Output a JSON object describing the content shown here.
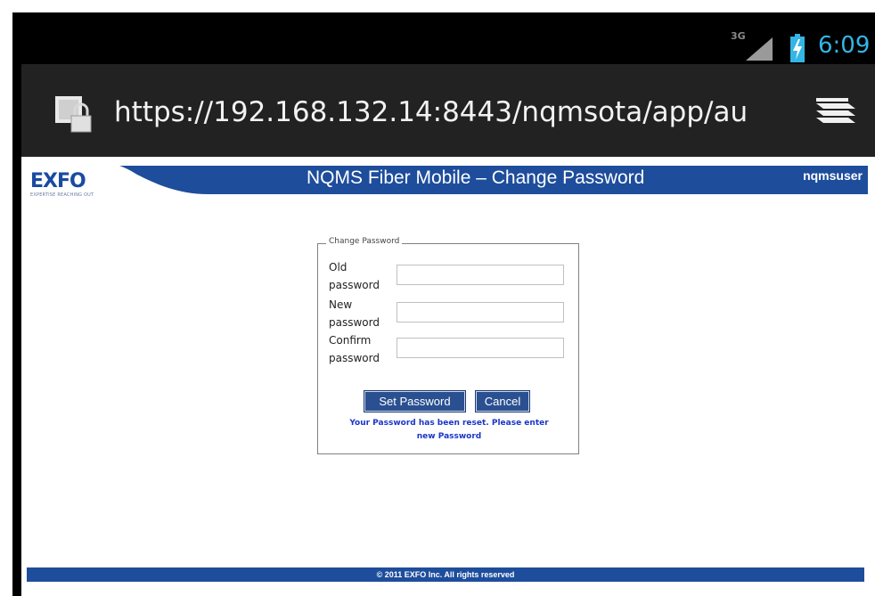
{
  "status_bar": {
    "network": "3G",
    "time": "6:09",
    "clock_color": "#33b5e5"
  },
  "browser": {
    "url": "https://192.168.132.14:8443/nqmsota/app/au",
    "icons": [
      "lock-icon",
      "menu-icon"
    ]
  },
  "header": {
    "logo": "EXFO",
    "tagline": "EXPERTISE REACHING OUT",
    "title": "NQMS Fiber Mobile – Change Password",
    "user": "nqmsuser",
    "band_color": "#1e4d9c"
  },
  "form": {
    "legend": "Change Password",
    "fields": [
      {
        "label_line1": "Old",
        "label_line2": "password",
        "value": ""
      },
      {
        "label_line1": "New",
        "label_line2": "password",
        "value": ""
      },
      {
        "label_line1": "Confirm",
        "label_line2": "password",
        "value": ""
      }
    ],
    "set_button": "Set Password",
    "cancel_button": "Cancel",
    "message_line1": "Your Password has been reset. Please enter",
    "message_line2": "new Password",
    "button_color": "#2a5091",
    "message_color": "#1a35c8"
  },
  "footer": {
    "text": "© 2011 EXFO Inc. All rights reserved"
  }
}
